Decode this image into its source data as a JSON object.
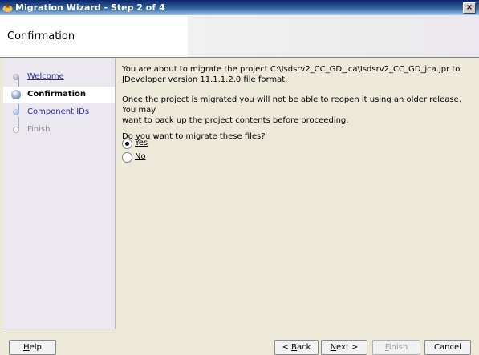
{
  "window": {
    "title": "Migration Wizard - Step 2 of 4",
    "close_glyph": "×"
  },
  "header": {
    "title": "Confirmation"
  },
  "steps": [
    {
      "label": "Welcome",
      "state": "visited"
    },
    {
      "label": "Confirmation",
      "state": "current"
    },
    {
      "label": "Component IDs",
      "state": "next"
    },
    {
      "label": "Finish",
      "state": "disabled"
    }
  ],
  "content": {
    "paragraph1_line1": "You are about to migrate the project C:\\Isdsrv2_CC_GD_jca\\Isdsrv2_CC_GD_jca.jpr to",
    "paragraph1_line2": "JDeveloper version 11.1.1.2.0 file format.",
    "paragraph2_line1": "Once the project is migrated you will not be able to reopen it using an older release. You may",
    "paragraph2_line2": "want to back up the project contents before proceeding.",
    "question": "Do you want to migrate these files?",
    "options": [
      {
        "label": "Yes",
        "selected": true
      },
      {
        "label": "No",
        "selected": false
      }
    ]
  },
  "buttons": {
    "help": {
      "mnemonic": "H",
      "rest": "elp"
    },
    "back": {
      "prefix": "< ",
      "mnemonic": "B",
      "rest": "ack"
    },
    "next": {
      "mnemonic": "N",
      "rest": "ext >"
    },
    "finish": {
      "mnemonic": "F",
      "rest": "inish"
    },
    "cancel": {
      "label": "Cancel"
    }
  },
  "colors": {
    "title_bar": "#0a246a",
    "dialog_bg": "#ece9d8",
    "sidebar_bg": "#ebe8f0",
    "link": "#2a2a99"
  }
}
